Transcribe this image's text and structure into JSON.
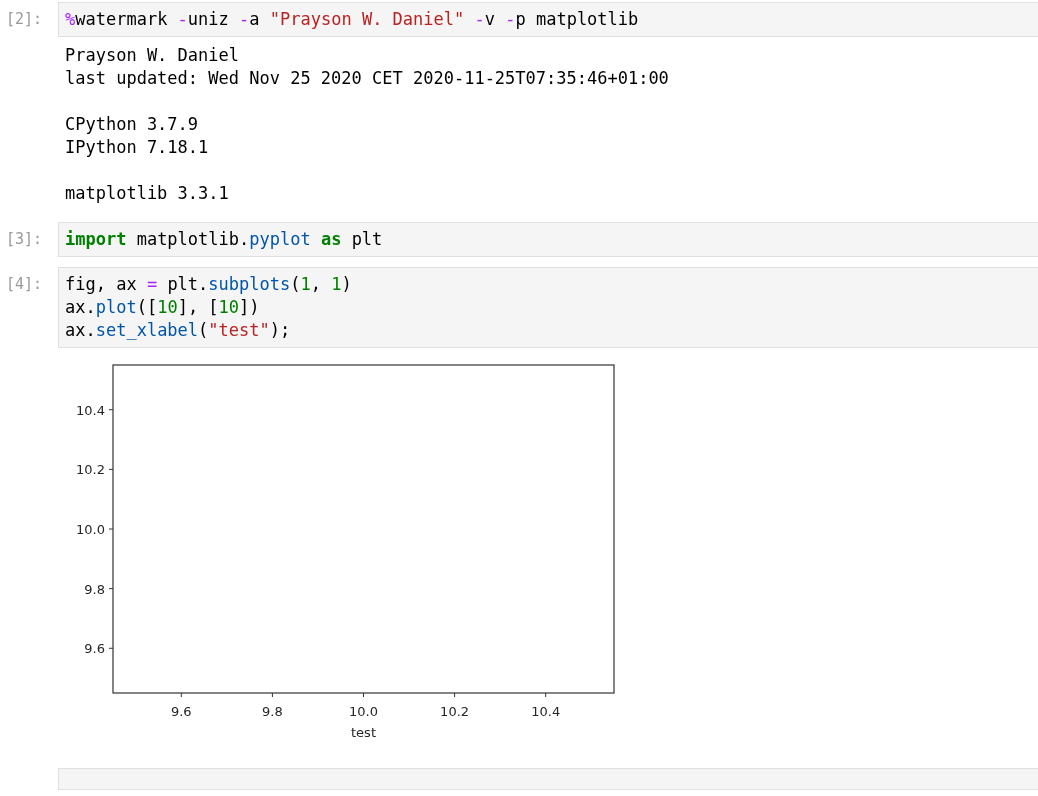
{
  "cells": [
    {
      "prompt": "[2]:",
      "code": [
        [
          {
            "kind": "magic",
            "text": "%"
          },
          {
            "kind": "plain",
            "text": "watermark "
          },
          {
            "kind": "operator",
            "text": "-"
          },
          {
            "kind": "plain",
            "text": "uniz "
          },
          {
            "kind": "operator",
            "text": "-"
          },
          {
            "kind": "plain",
            "text": "a "
          },
          {
            "kind": "string",
            "text": "\"Prayson W. Daniel\""
          },
          {
            "kind": "operator",
            "text": " -"
          },
          {
            "kind": "plain",
            "text": "v "
          },
          {
            "kind": "operator",
            "text": "-"
          },
          {
            "kind": "plain",
            "text": "p matplotlib"
          }
        ]
      ],
      "output": {
        "kind": "text",
        "paragraphs": [
          [
            "Prayson W. Daniel",
            "last updated: Wed Nov 25 2020 CET 2020-11-25T07:35:46+01:00"
          ],
          [
            "CPython 3.7.9",
            "IPython 7.18.1"
          ],
          [
            "matplotlib 3.3.1"
          ]
        ]
      }
    },
    {
      "prompt": "[3]:",
      "code": [
        [
          {
            "kind": "keyword",
            "text": "import"
          },
          {
            "kind": "plain",
            "text": " matplotlib."
          },
          {
            "kind": "builtin",
            "text": "pyplot"
          },
          {
            "kind": "keyword",
            "text": " as"
          },
          {
            "kind": "plain",
            "text": " plt"
          }
        ]
      ]
    },
    {
      "prompt": "[4]:",
      "code": [
        [
          {
            "kind": "plain",
            "text": "fig, ax "
          },
          {
            "kind": "operator",
            "text": "="
          },
          {
            "kind": "plain",
            "text": " plt."
          },
          {
            "kind": "builtin",
            "text": "subplots"
          },
          {
            "kind": "plain",
            "text": "("
          },
          {
            "kind": "number",
            "text": "1"
          },
          {
            "kind": "plain",
            "text": ", "
          },
          {
            "kind": "number",
            "text": "1"
          },
          {
            "kind": "plain",
            "text": ")"
          }
        ],
        [
          {
            "kind": "plain",
            "text": "ax."
          },
          {
            "kind": "builtin",
            "text": "plot"
          },
          {
            "kind": "plain",
            "text": "(["
          },
          {
            "kind": "number",
            "text": "10"
          },
          {
            "kind": "plain",
            "text": "], ["
          },
          {
            "kind": "number",
            "text": "10"
          },
          {
            "kind": "plain",
            "text": "])"
          }
        ],
        [
          {
            "kind": "plain",
            "text": "ax."
          },
          {
            "kind": "builtin",
            "text": "set_xlabel"
          },
          {
            "kind": "plain",
            "text": "("
          },
          {
            "kind": "string",
            "text": "\"test\""
          },
          {
            "kind": "plain",
            "text": ");"
          }
        ]
      ],
      "output": {
        "kind": "chart",
        "chart_data": {
          "type": "line",
          "xlabel": "test",
          "xlim": [
            9.45,
            10.55
          ],
          "ylim": [
            9.45,
            10.55
          ],
          "xticks": [
            {
              "value": 9.6,
              "label": "9.6"
            },
            {
              "value": 9.8,
              "label": "9.8"
            },
            {
              "value": 10.0,
              "label": "10.0"
            },
            {
              "value": 10.2,
              "label": "10.2"
            },
            {
              "value": 10.4,
              "label": "10.4"
            }
          ],
          "yticks": [
            {
              "value": 9.6,
              "label": "9.6"
            },
            {
              "value": 9.8,
              "label": "9.8"
            },
            {
              "value": 10.0,
              "label": "10.0"
            },
            {
              "value": 10.2,
              "label": "10.2"
            },
            {
              "value": 10.4,
              "label": "10.4"
            }
          ]
        }
      }
    }
  ]
}
